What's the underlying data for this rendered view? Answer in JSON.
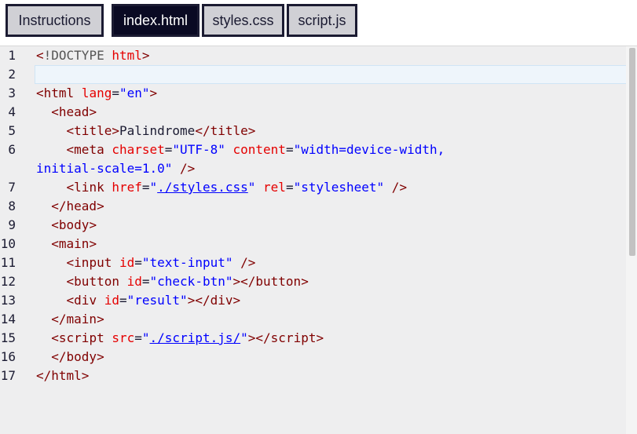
{
  "tabs": [
    {
      "label": "Instructions",
      "active": false
    },
    {
      "label": "index.html",
      "active": true
    },
    {
      "label": "styles.css",
      "active": false
    },
    {
      "label": "script.js",
      "active": false
    }
  ],
  "line_numbers": [
    "1",
    "2",
    "3",
    "4",
    "5",
    "6",
    "",
    "7",
    "8",
    "9",
    "10",
    "11",
    "12",
    "13",
    "14",
    "15",
    "16",
    "17"
  ],
  "code": {
    "l1": {
      "open": "<",
      "doctype": "!DOCTYPE",
      "sp": " ",
      "html": "html",
      "close": ">"
    },
    "l3": {
      "open": "<",
      "tag": "html",
      "attr": "lang",
      "eq": "=",
      "val": "\"en\"",
      "close": ">"
    },
    "l4": {
      "indent": "  ",
      "open": "<",
      "tag": "head",
      "close": ">"
    },
    "l5": {
      "indent": "    ",
      "open": "<",
      "tag": "title",
      "close": ">",
      "text": "Palindrome",
      "open2": "</",
      "tag2": "title",
      "close2": ">"
    },
    "l6": {
      "indent": "    ",
      "open": "<",
      "tag": "meta",
      "attr1": "charset",
      "eq1": "=",
      "val1": "\"UTF-8\"",
      "attr2": "content",
      "eq2": "=",
      "val2": "\"width=device-width,"
    },
    "l6b": {
      "val": "initial-scale=1.0\"",
      "close": " />"
    },
    "l7": {
      "indent": "    ",
      "open": "<",
      "tag": "link",
      "attr1": "href",
      "eq1": "=",
      "q1": "\"",
      "link": "./styles.css",
      "q2": "\"",
      "attr2": "rel",
      "eq2": "=",
      "val2": "\"stylesheet\"",
      "close": " />"
    },
    "l8": {
      "indent": "  ",
      "open": "</",
      "tag": "head",
      "close": ">"
    },
    "l9": {
      "indent": "  ",
      "open": "<",
      "tag": "body",
      "close": ">"
    },
    "l10": {
      "indent": "  ",
      "open": "<",
      "tag": "main",
      "close": ">"
    },
    "l11": {
      "indent": "    ",
      "open": "<",
      "tag": "input",
      "attr": "id",
      "eq": "=",
      "val": "\"text-input\"",
      "close": " />"
    },
    "l12": {
      "indent": "    ",
      "open": "<",
      "tag": "button",
      "attr": "id",
      "eq": "=",
      "val": "\"check-btn\"",
      "mid": "></",
      "tag2": "button",
      "close": ">"
    },
    "l13": {
      "indent": "    ",
      "open": "<",
      "tag": "div",
      "attr": "id",
      "eq": "=",
      "val": "\"result\"",
      "mid": "></",
      "tag2": "div",
      "close": ">"
    },
    "l14": {
      "indent": "  ",
      "open": "</",
      "tag": "main",
      "close": ">"
    },
    "l15": {
      "indent": "  ",
      "open": "<",
      "tag": "script",
      "attr": "src",
      "eq": "=",
      "q1": "\"",
      "link": "./script.js/",
      "q2": "\"",
      "mid": "></",
      "tag2": "script",
      "close": ">"
    },
    "l16": {
      "indent": "  ",
      "open": "</",
      "tag": "body",
      "close": ">"
    },
    "l17": {
      "open": "</",
      "tag": "html",
      "close": ">"
    }
  },
  "colors": {
    "tab_active_bg": "#0a0a23",
    "tab_inactive_bg": "#d0d0d5",
    "editor_bg": "#eeeeef",
    "tag_color": "#800000",
    "attr_color": "#e50000",
    "value_color": "#0000ff"
  }
}
